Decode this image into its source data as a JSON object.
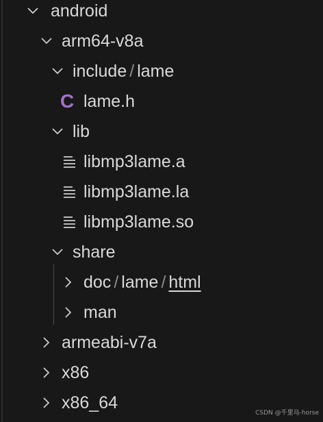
{
  "tree": {
    "nodes": [
      {
        "id": "android",
        "label": "android",
        "state": "expanded"
      },
      {
        "id": "arm64",
        "label": "arm64-v8a",
        "state": "expanded"
      },
      {
        "id": "include",
        "parts": [
          "include",
          "lame"
        ],
        "state": "expanded"
      },
      {
        "id": "lame_h",
        "label": "lame.h",
        "icon": "c-file-icon"
      },
      {
        "id": "lib",
        "label": "lib",
        "state": "expanded"
      },
      {
        "id": "lib_a",
        "label": "libmp3lame.a",
        "icon": "text-file-icon"
      },
      {
        "id": "lib_la",
        "label": "libmp3lame.la",
        "icon": "text-file-icon"
      },
      {
        "id": "lib_so",
        "label": "libmp3lame.so",
        "icon": "text-file-icon"
      },
      {
        "id": "share",
        "label": "share",
        "state": "expanded"
      },
      {
        "id": "doc",
        "parts": [
          "doc",
          "lame",
          "html"
        ],
        "state": "collapsed"
      },
      {
        "id": "man",
        "label": "man",
        "state": "collapsed"
      },
      {
        "id": "armeabi",
        "label": "armeabi-v7a",
        "state": "collapsed"
      },
      {
        "id": "x86",
        "label": "x86",
        "state": "collapsed"
      },
      {
        "id": "x86_64",
        "label": "x86_64",
        "state": "collapsed"
      }
    ]
  },
  "watermark": "CSDN @千里马-horse",
  "colors": {
    "background": "#181818",
    "text": "#d9d9d9",
    "chevron": "#cccccc",
    "c_icon": "#a074c4",
    "guide": "#4a4a4a"
  }
}
